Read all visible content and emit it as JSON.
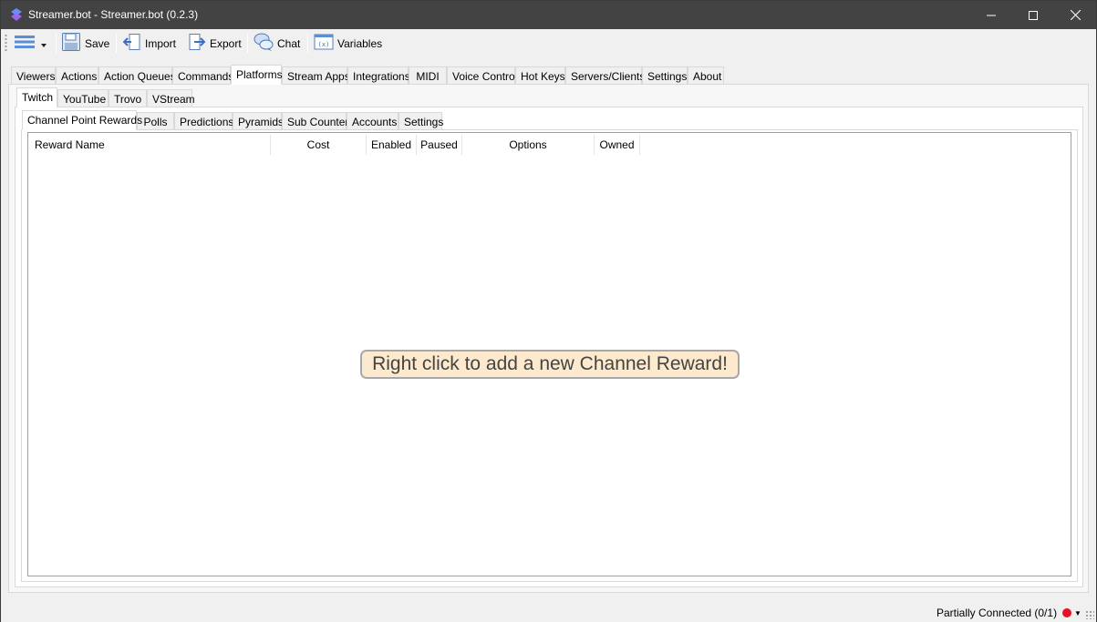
{
  "window": {
    "title": "Streamer.bot - Streamer.bot (0.2.3)"
  },
  "toolbar": {
    "menu_icon": "hamburger-menu-icon",
    "save_label": "Save",
    "import_label": "Import",
    "export_label": "Export",
    "chat_label": "Chat",
    "variables_label": "Variables"
  },
  "main_tabs": [
    {
      "label": "Viewers"
    },
    {
      "label": "Actions"
    },
    {
      "label": "Action Queues"
    },
    {
      "label": "Commands"
    },
    {
      "label": "Platforms",
      "active": true
    },
    {
      "label": "Stream Apps"
    },
    {
      "label": "Integrations"
    },
    {
      "label": "MIDI"
    },
    {
      "label": "Voice Control"
    },
    {
      "label": "Hot Keys"
    },
    {
      "label": "Servers/Clients"
    },
    {
      "label": "Settings"
    },
    {
      "label": "About"
    }
  ],
  "platform_tabs": [
    {
      "label": "Twitch",
      "active": true
    },
    {
      "label": "YouTube"
    },
    {
      "label": "Trovo"
    },
    {
      "label": "VStream"
    }
  ],
  "twitch_tabs": [
    {
      "label": "Channel Point Rewards",
      "active": true
    },
    {
      "label": "Polls"
    },
    {
      "label": "Predictions"
    },
    {
      "label": "Pyramids"
    },
    {
      "label": "Sub Counter"
    },
    {
      "label": "Accounts"
    },
    {
      "label": "Settings"
    }
  ],
  "rewards_table": {
    "columns": [
      "Reward Name",
      "Cost",
      "Enabled",
      "Paused",
      "Options",
      "Owned"
    ],
    "rows": [],
    "empty_message": "Right click to add a new Channel Reward!"
  },
  "status": {
    "connection_text": "Partially Connected (0/1)",
    "connection_color": "#e81123"
  },
  "colors": {
    "titlebar": "#434343",
    "empty_message_bg": "#fde9cd"
  }
}
